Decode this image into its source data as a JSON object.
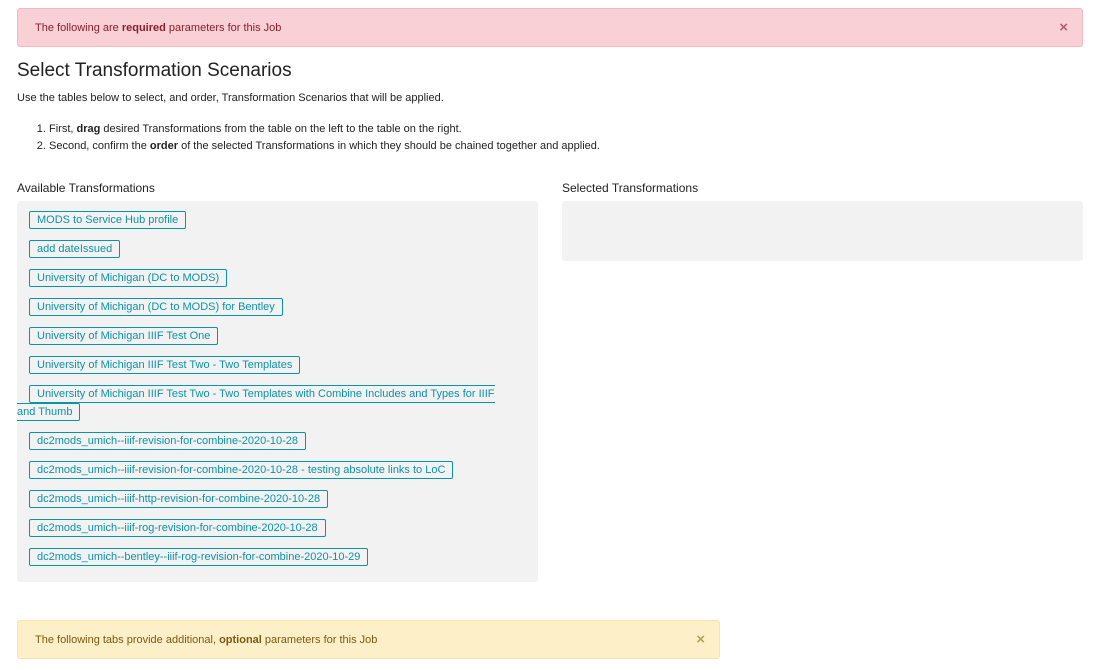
{
  "alerts": {
    "required": {
      "prefix": "The following are ",
      "bold": "required",
      "suffix": " parameters for this Job",
      "close_label": "×"
    },
    "optional": {
      "prefix": "The following tabs provide additional, ",
      "bold": "optional",
      "suffix": " parameters for this Job",
      "close_label": "×"
    }
  },
  "section": {
    "title": "Select Transformation Scenarios",
    "intro": "Use the tables below to select, and order, Transformation Scenarios that will be applied.",
    "steps": [
      {
        "prefix": "First, ",
        "bold": "drag",
        "suffix": " desired Transformations from the table on the left to the table on the right."
      },
      {
        "prefix": "Second, confirm the ",
        "bold": "order",
        "suffix": " of the selected Transformations in which they should be chained together and applied."
      }
    ]
  },
  "available": {
    "label": "Available Transformations",
    "items": [
      "MODS to Service Hub profile",
      "add dateIssued",
      "University of Michigan (DC to MODS)",
      "University of Michigan (DC to MODS) for Bentley",
      "University of Michigan IIIF Test One",
      "University of Michigan IIIF Test Two - Two Templates",
      "University of Michigan IIIF Test Two - Two Templates with Combine Includes and Types for IIIF and Thumb",
      "dc2mods_umich--iiif-revision-for-combine-2020-10-28",
      "dc2mods_umich--iiif-revision-for-combine-2020-10-28 - testing absolute links to LoC",
      "dc2mods_umich--iiif-http-revision-for-combine-2020-10-28",
      "dc2mods_umich--iiif-rog-revision-for-combine-2020-10-28",
      "dc2mods_umich--bentley--iiif-rog-revision-for-combine-2020-10-29"
    ]
  },
  "selected": {
    "label": "Selected Transformations",
    "items": []
  }
}
